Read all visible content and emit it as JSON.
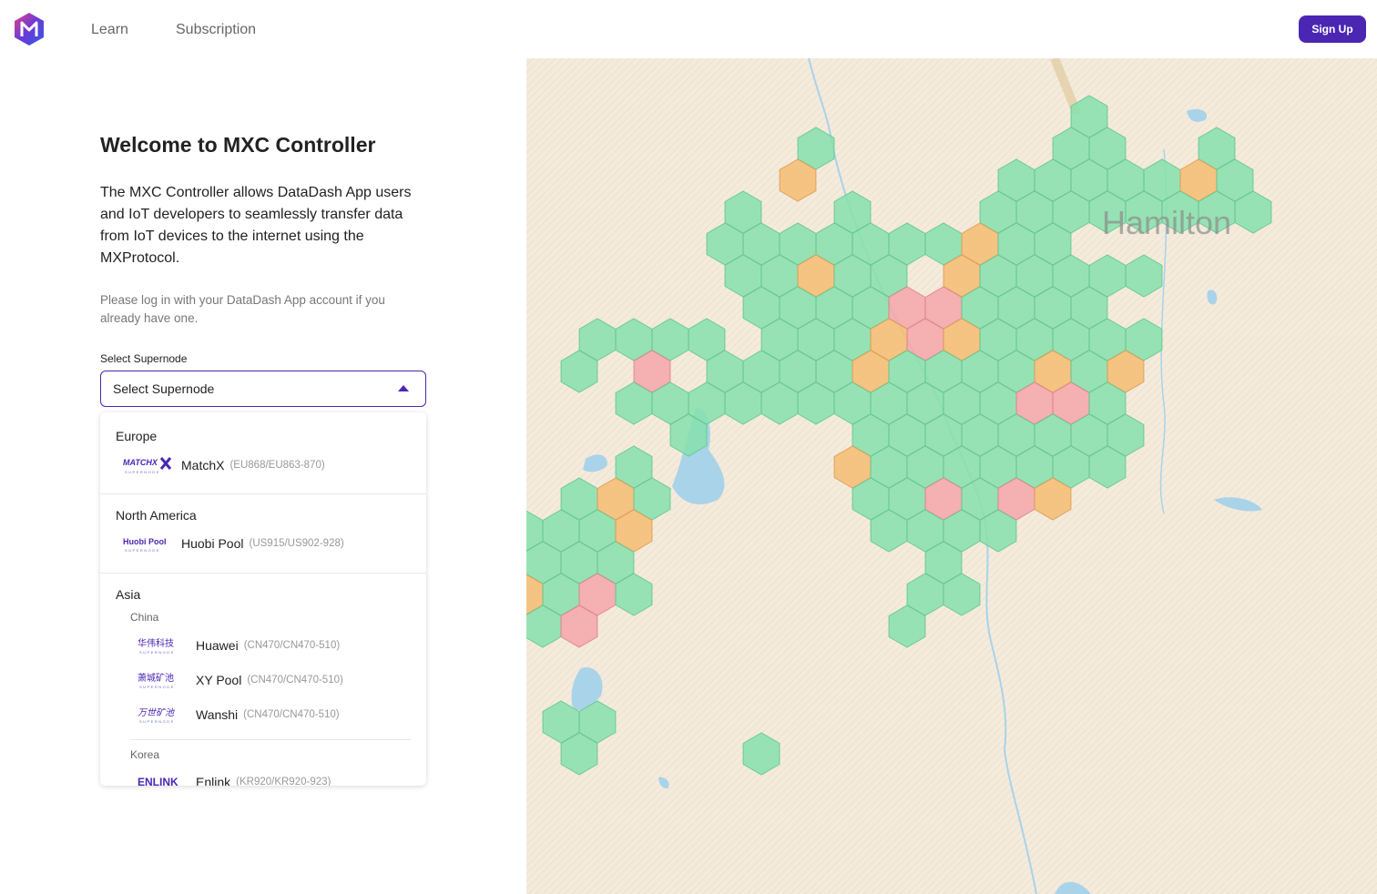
{
  "header": {
    "nav": [
      {
        "label": "Learn"
      },
      {
        "label": "Subscription"
      }
    ],
    "signup_label": "Sign Up"
  },
  "welcome": {
    "title": "Welcome to MXC Controller",
    "description": "The MXC Controller allows DataDash App users and IoT developers to seamlessly transfer data from IoT devices to the internet using the MXProtocol.",
    "hint": "Please log in with your DataDash App account if you already have one."
  },
  "supernode_select": {
    "label": "Select Supernode",
    "value": "Select Supernode",
    "regions": [
      {
        "name": "Europe",
        "options": [
          {
            "name": "MatchX",
            "freq": "(EU868/EU863-870)",
            "logo_text": "MATCHX"
          }
        ]
      },
      {
        "name": "North America",
        "options": [
          {
            "name": "Huobi Pool",
            "freq": "(US915/US902-928)",
            "logo_text": "Huobi Pool"
          }
        ]
      },
      {
        "name": "Asia",
        "subregions": [
          {
            "name": "China",
            "options": [
              {
                "name": "Huawei",
                "freq": "(CN470/CN470-510)",
                "logo_text": "华伟科技"
              },
              {
                "name": "XY Pool",
                "freq": "(CN470/CN470-510)",
                "logo_text": "萧城矿池"
              },
              {
                "name": "Wanshi",
                "freq": "(CN470/CN470-510)",
                "logo_text": "万世矿池"
              }
            ]
          },
          {
            "name": "Korea",
            "options": [
              {
                "name": "Enlink",
                "freq": "(KR920/KR920-923)",
                "logo_text": "ENLINK"
              }
            ]
          }
        ]
      }
    ]
  },
  "map": {
    "place_label": "Hamilton",
    "colors": {
      "green": "#86e0ad",
      "orange": "#f5bc72",
      "red": "#f5a6a9",
      "water": "#a9d3e8",
      "land": "#f4ebdd"
    }
  },
  "colors": {
    "accent": "#4a26b3"
  }
}
